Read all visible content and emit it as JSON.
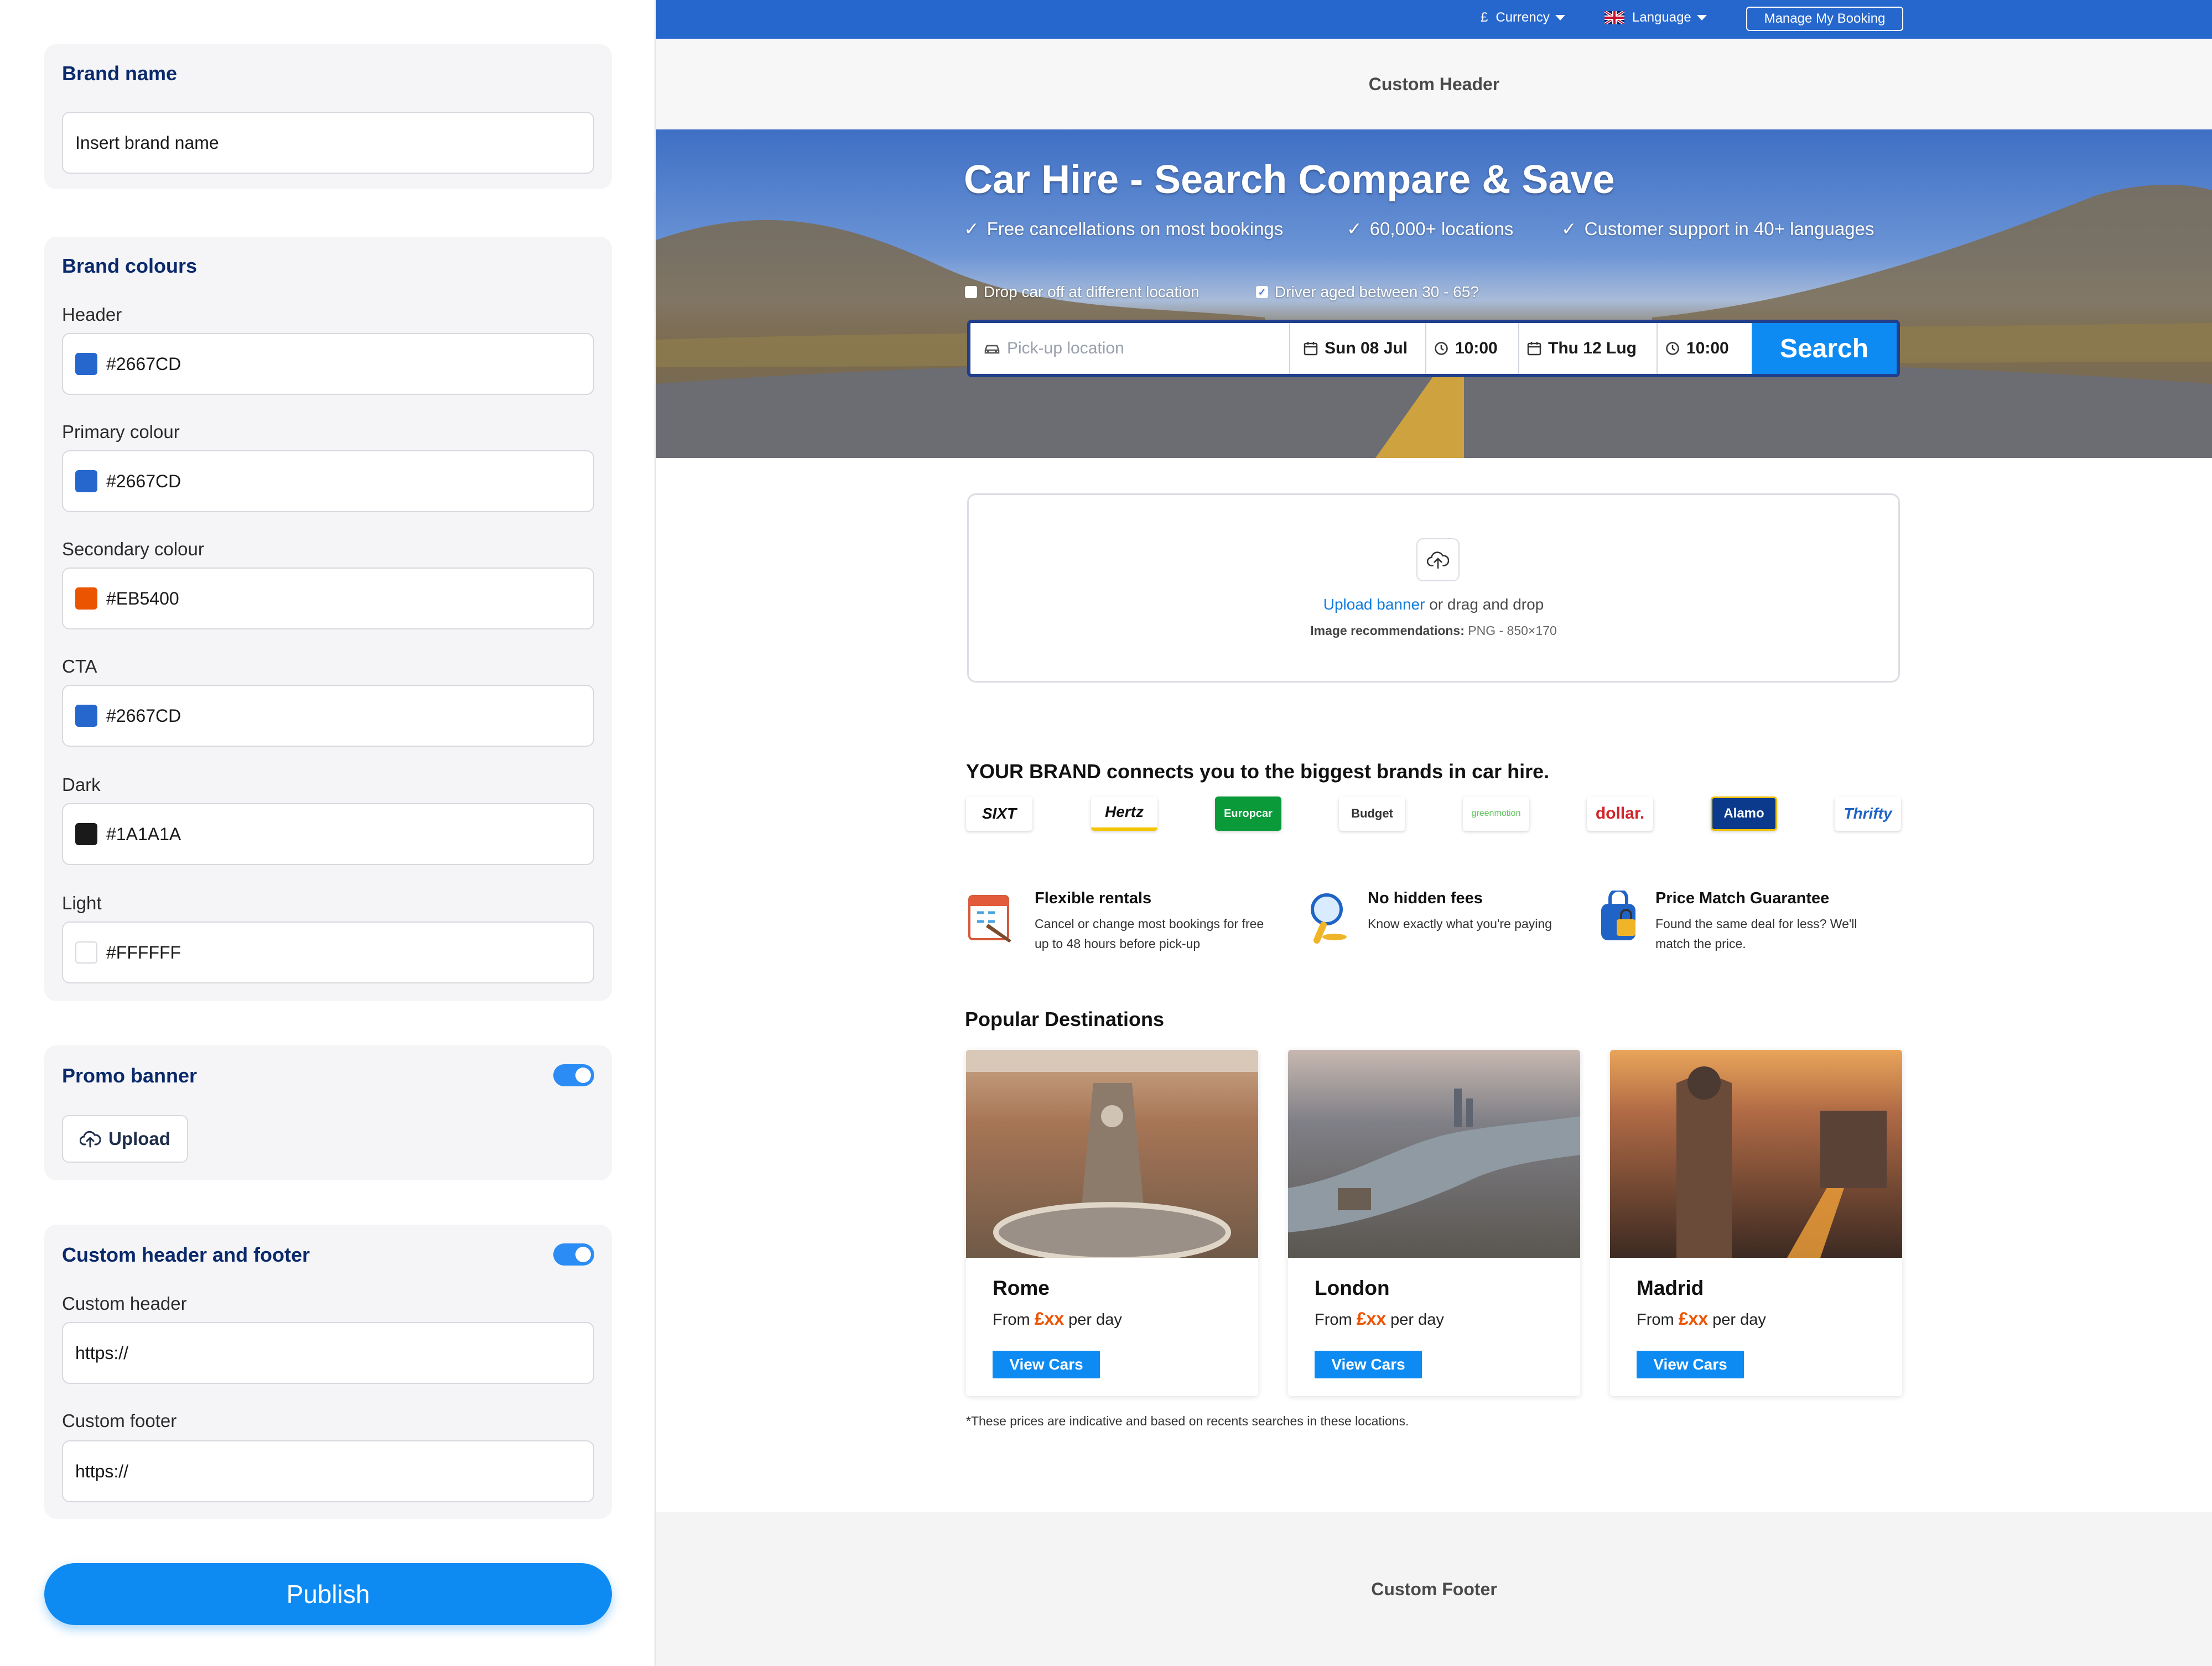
{
  "editor": {
    "brand_name": {
      "title": "Brand name",
      "placeholder": "Insert brand name"
    },
    "brand_colours": {
      "title": "Brand colours",
      "fields": [
        {
          "label": "Header",
          "value": "#2667CD",
          "color": "#2667CD"
        },
        {
          "label": "Primary colour",
          "value": "#2667CD",
          "color": "#2667CD"
        },
        {
          "label": "Secondary colour",
          "value": "#EB5400",
          "color": "#EB5400"
        },
        {
          "label": "CTA",
          "value": "#2667CD",
          "color": "#2667CD"
        },
        {
          "label": "Dark",
          "value": "#1A1A1A",
          "color": "#1A1A1A"
        },
        {
          "label": "Light",
          "value": "#FFFFFF",
          "color": "#FFFFFF"
        }
      ]
    },
    "promo_banner": {
      "title": "Promo banner",
      "enabled": true,
      "upload_label": "Upload"
    },
    "custom_header_footer": {
      "title": "Custom header and footer",
      "enabled": true,
      "header_label": "Custom header",
      "header_value": "https://",
      "footer_label": "Custom footer",
      "footer_value": "https://"
    },
    "publish_label": "Publish"
  },
  "preview": {
    "topbar": {
      "currency_symbol": "£",
      "currency_label": "Currency",
      "language_label": "Language",
      "manage_booking": "Manage My Booking"
    },
    "custom_header": "Custom Header",
    "hero": {
      "title": "Car Hire - Search Compare & Save",
      "features": [
        "Free cancellations on most bookings",
        "60,000+ locations",
        "Customer support in 40+ languages"
      ],
      "checkbox_dropoff": "Drop car off at different location",
      "checkbox_driver": "Driver aged between 30 - 65?",
      "pickup_placeholder": "Pick-up location",
      "pickup_date": "Sun 08 Jul",
      "pickup_time": "10:00",
      "return_date": "Thu 12 Lug",
      "return_time": "10:00",
      "search_label": "Search"
    },
    "banner_upload": {
      "link": "Upload banner",
      "text": " or drag and drop",
      "rec_label": "Image recommendations:",
      "rec_value": " PNG - 850×170"
    },
    "brands": {
      "title": "YOUR BRAND connects you to the biggest brands in car hire.",
      "logos": [
        "SIXT",
        "Hertz",
        "Europcar",
        "Budget",
        "greenmotion",
        "dollar.",
        "Alamo",
        "Thrifty"
      ]
    },
    "features": [
      {
        "title": "Flexible rentals",
        "desc": "Cancel or change most bookings for free up to 48 hours before pick-up",
        "icon": "calendar-icon"
      },
      {
        "title": "No hidden fees",
        "desc": "Know exactly what you're paying",
        "icon": "magnifier-icon"
      },
      {
        "title": "Price Match Guarantee",
        "desc": "Found the same deal for less? We'll match the price.",
        "icon": "lock-bag-icon"
      }
    ],
    "popular": {
      "title": "Popular Destinations",
      "price_from": "From ",
      "price_value": "£xx",
      "price_suffix": " per day",
      "button": "View Cars",
      "cities": [
        "Rome",
        "London",
        "Madrid"
      ]
    },
    "disclaimer": "*These prices are indicative and based on recents searches in these locations.",
    "custom_footer": "Custom Footer"
  }
}
